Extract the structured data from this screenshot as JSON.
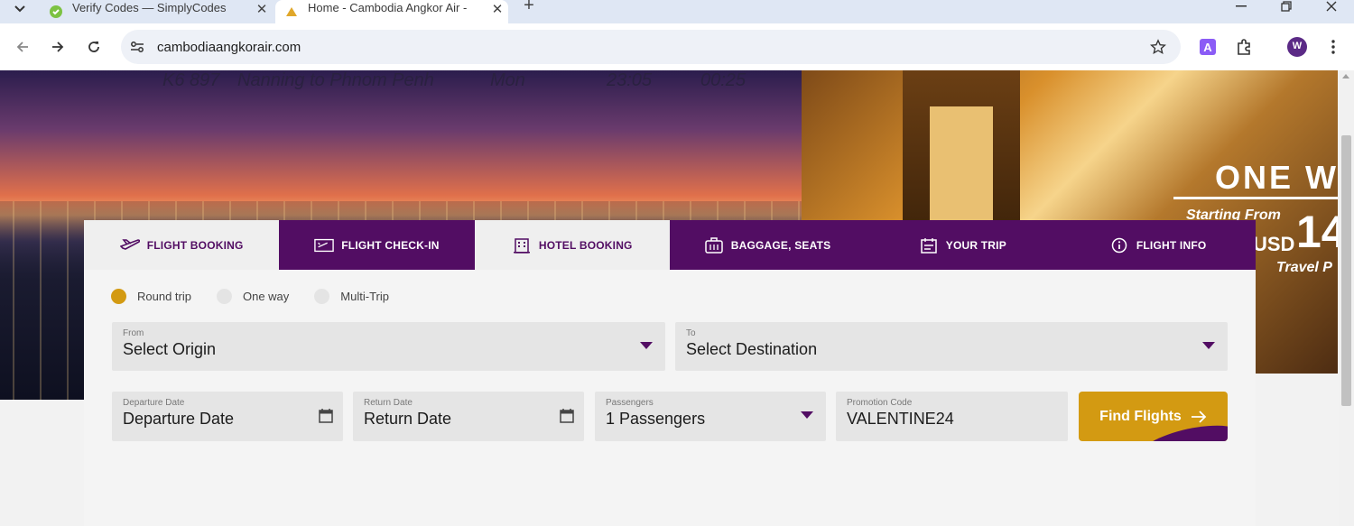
{
  "browser": {
    "tabs": [
      {
        "title": "Verify Codes — SimplyCodes",
        "active": false
      },
      {
        "title": "Home - Cambodia Angkor Air -",
        "active": true
      }
    ],
    "url": "cambodiaangkorair.com",
    "profile_initial": "W",
    "colors": {
      "tabstrip": "#dfe7f4",
      "profile": "#5b2a86"
    }
  },
  "hero": {
    "schedule": {
      "flight": "K6 897",
      "route": "Nanning to Phnom Penh",
      "day": "Mon",
      "depart": "23:05",
      "arrive": "00:25"
    },
    "promo": {
      "headline": "ONE W",
      "starting_from": "Starting From",
      "currency": "USD",
      "price": "14",
      "note": "Travel P"
    }
  },
  "booking": {
    "tabs": [
      {
        "label": "FLIGHT BOOKING",
        "icon": "plane-icon",
        "active": true
      },
      {
        "label": "FLIGHT CHECK-IN",
        "icon": "ticket-icon",
        "active": false
      },
      {
        "label": "HOTEL BOOKING",
        "icon": "hotel-icon",
        "active": false
      },
      {
        "label": "BAGGAGE, SEATS",
        "icon": "baggage-icon",
        "active": false
      },
      {
        "label": "YOUR TRIP",
        "icon": "trip-icon",
        "active": false
      },
      {
        "label": "FLIGHT INFO",
        "icon": "info-icon",
        "active": false
      }
    ],
    "trip_types": [
      "Round trip",
      "One way",
      "Multi-Trip"
    ],
    "selected_trip": "Round trip",
    "from": {
      "label": "From",
      "value": "Select Origin"
    },
    "to": {
      "label": "To",
      "value": "Select Destination"
    },
    "departure": {
      "label": "Departure Date",
      "value": "Departure Date"
    },
    "return": {
      "label": "Return Date",
      "value": "Return Date"
    },
    "passengers": {
      "label": "Passengers",
      "value": "1 Passengers"
    },
    "promo_code": {
      "label": "Promotion Code",
      "value": "VALENTINE24"
    },
    "find_button": "Find Flights",
    "colors": {
      "primary": "#520d63",
      "accent": "#d39a12"
    }
  }
}
